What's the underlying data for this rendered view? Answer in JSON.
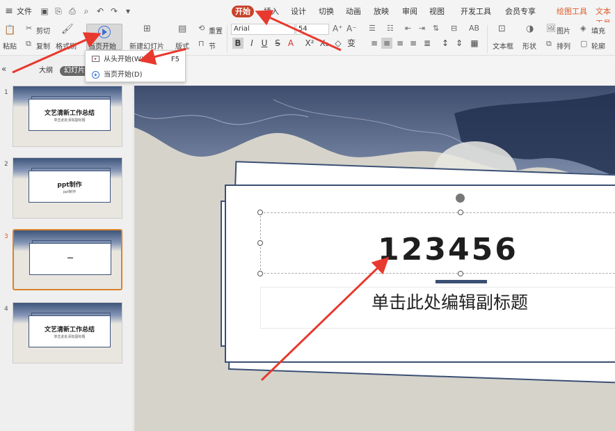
{
  "menubar": {
    "file_label": "文件",
    "tabs": [
      {
        "label": "开始",
        "active": true
      },
      {
        "label": "插入"
      },
      {
        "label": "设计"
      },
      {
        "label": "切换"
      },
      {
        "label": "动画"
      },
      {
        "label": "放映"
      },
      {
        "label": "审阅"
      },
      {
        "label": "视图"
      },
      {
        "label": "开发工具"
      },
      {
        "label": "会员专享"
      },
      {
        "label": "绘图工具"
      },
      {
        "label": "文本工具"
      }
    ]
  },
  "ribbon": {
    "paste": "粘贴",
    "cut": "剪切",
    "copy": "复制",
    "format_painter": "格式刷",
    "play_from_current": "当页开始",
    "new_slide": "新建幻灯片",
    "layout": "版式",
    "reset": "重置",
    "section": "节",
    "font_name": "Arial",
    "font_size": "54",
    "textbox": "文本框",
    "shape": "形状",
    "picture": "图片",
    "arrange": "排列",
    "fill": "填充",
    "outline": "轮廓",
    "colors": {
      "active_tab": "#c8432b",
      "accent": "#3b6fd8"
    }
  },
  "dropdown": {
    "items": [
      {
        "label": "从头开始(W)",
        "shortcut": "F5"
      },
      {
        "label": "当页开始(D)",
        "shortcut": ""
      }
    ]
  },
  "leftpanel": {
    "view_tabs": [
      "大纲",
      "幻灯片"
    ],
    "slides": [
      {
        "num": "1",
        "title": "文艺清新工作总结",
        "subtitle": "单击此处添加副标题"
      },
      {
        "num": "2",
        "title": "ppt制作",
        "subtitle": "ppt制作"
      },
      {
        "num": "3",
        "title": "—",
        "subtitle": "",
        "active": true
      },
      {
        "num": "4",
        "title": "文艺清新工作总结",
        "subtitle": "单击此处添加副标题"
      }
    ]
  },
  "slide": {
    "title": "123456",
    "subtitle": "单击此处编辑副标题"
  }
}
